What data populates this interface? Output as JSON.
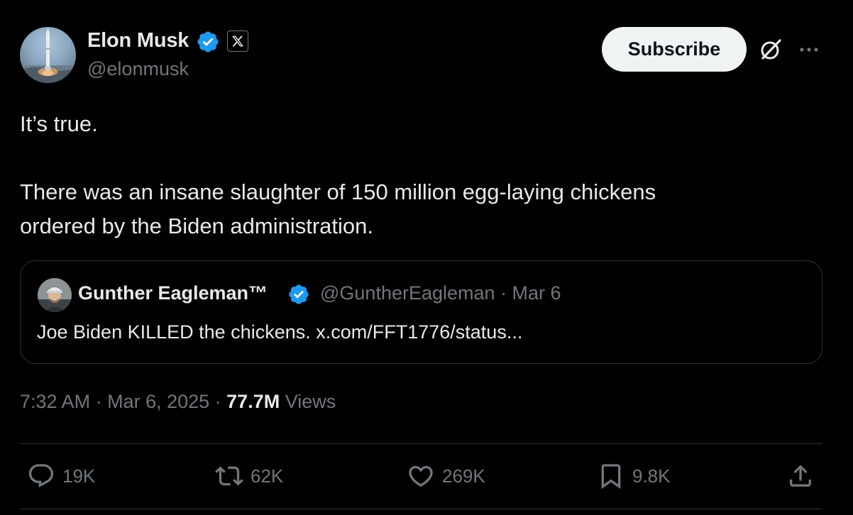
{
  "author": {
    "name": "Elon Musk",
    "handle": "@elonmusk"
  },
  "header": {
    "subscribe_label": "Subscribe"
  },
  "tweet": {
    "line1": "It’s true.",
    "line2": "There was an insane slaughter of 150 million egg-laying chickens",
    "line3": "ordered by the Biden administration."
  },
  "quote": {
    "name": "Gunther Eagleman™",
    "handle": "@GuntherEagleman",
    "date": "Mar 6",
    "text": "Joe Biden KILLED the chickens. x.com/FFT1776/status..."
  },
  "meta": {
    "time": "7:32 AM",
    "date": "Mar 6, 2025",
    "views_count": "77.7M",
    "views_label": "Views"
  },
  "actions": {
    "replies": "19K",
    "reposts": "62K",
    "likes": "269K",
    "bookmarks": "9.8K"
  },
  "icons": {
    "verified": "verified-badge-icon",
    "affiliate": "x-logo-icon",
    "grok": "grok-icon",
    "more": "more-icon",
    "reply": "reply-icon",
    "repost": "repost-icon",
    "like": "heart-icon",
    "bookmark": "bookmark-icon",
    "share": "share-icon"
  },
  "colors": {
    "background": "#000000",
    "text": "#e7e9ea",
    "secondary": "#71767b",
    "verified": "#1d9bf0",
    "border": "#2f3336",
    "subscribe_bg": "#eff3f4"
  }
}
